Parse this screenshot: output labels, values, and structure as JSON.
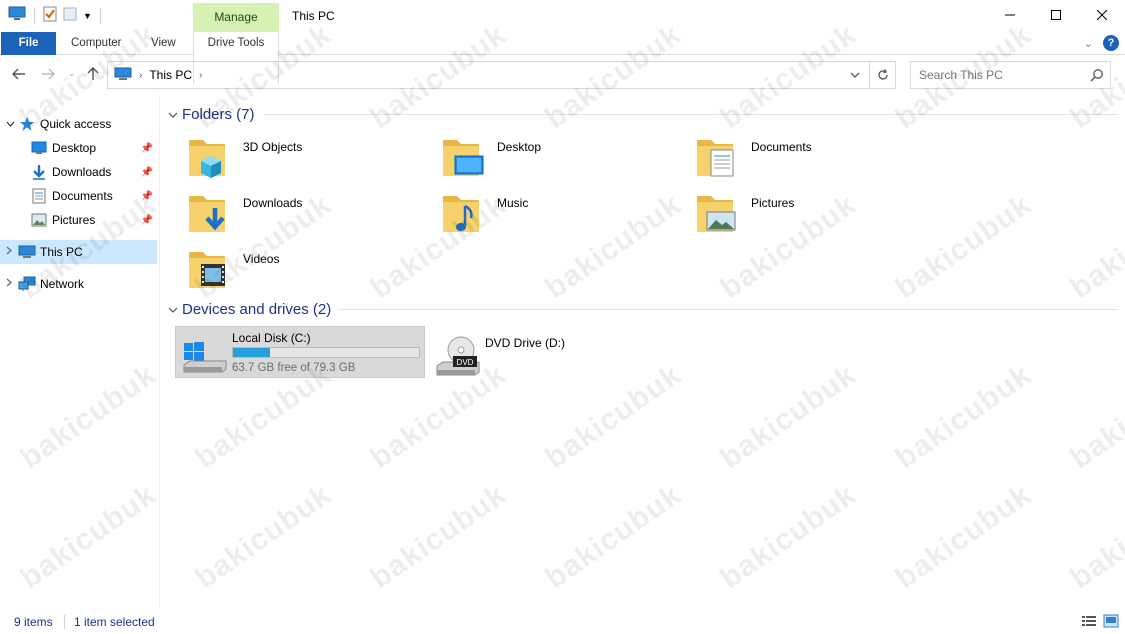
{
  "window": {
    "title": "This PC",
    "context_tab": "Manage"
  },
  "ribbon": {
    "tabs": [
      "File",
      "Computer",
      "View",
      "Drive Tools"
    ],
    "help_label": "?"
  },
  "address": {
    "location": "This PC",
    "search_placeholder": "Search This PC"
  },
  "nav": {
    "quick_access": "Quick access",
    "pinned": [
      {
        "label": "Desktop",
        "icon": "desktop-icon"
      },
      {
        "label": "Downloads",
        "icon": "downloads-icon"
      },
      {
        "label": "Documents",
        "icon": "documents-icon"
      },
      {
        "label": "Pictures",
        "icon": "pictures-icon"
      }
    ],
    "this_pc": "This PC",
    "network": "Network"
  },
  "folders": {
    "header": "Folders (7)",
    "items": [
      {
        "label": "3D Objects",
        "icon": "3d-objects-folder-icon"
      },
      {
        "label": "Desktop",
        "icon": "desktop-folder-icon"
      },
      {
        "label": "Documents",
        "icon": "documents-folder-icon"
      },
      {
        "label": "Downloads",
        "icon": "downloads-folder-icon"
      },
      {
        "label": "Music",
        "icon": "music-folder-icon"
      },
      {
        "label": "Pictures",
        "icon": "pictures-folder-icon"
      },
      {
        "label": "Videos",
        "icon": "videos-folder-icon"
      }
    ]
  },
  "drives": {
    "header": "Devices and drives (2)",
    "items": [
      {
        "label": "Local Disk (C:)",
        "free": "63.7 GB free of 79.3 GB",
        "used_fraction": 0.197,
        "selected": true
      },
      {
        "label": "DVD Drive (D:)",
        "badge": "DVD",
        "selected": false
      }
    ]
  },
  "status": {
    "items": "9 items",
    "selected": "1 item selected"
  },
  "colors": {
    "accent": "#1a63b8",
    "manage_tab": "#d6f1b3",
    "selection": "#cce8ff",
    "group_header": "#1e3287",
    "drive_bar": "#26a0da"
  },
  "watermark": "bakicubuk"
}
